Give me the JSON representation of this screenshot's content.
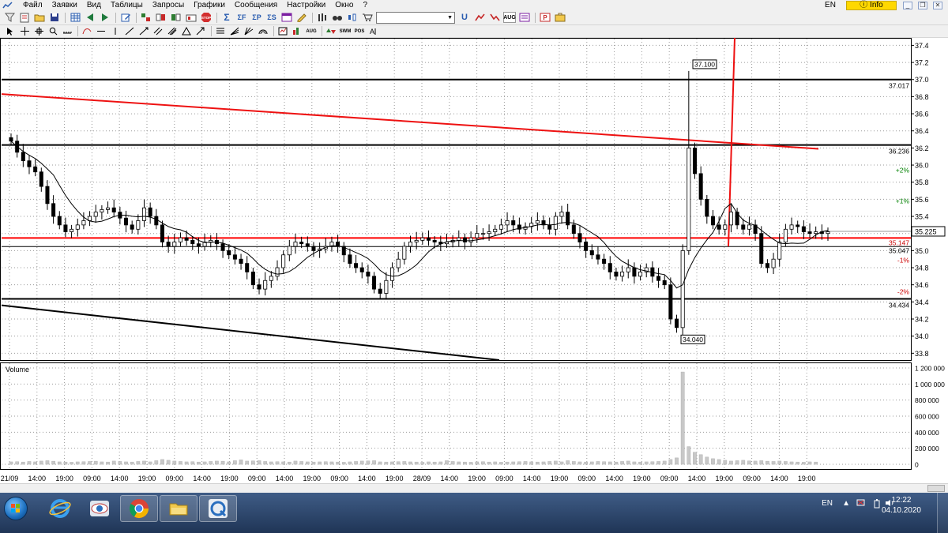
{
  "menu": {
    "items": [
      "Файл",
      "Заявки",
      "Вид",
      "Таблицы",
      "Запросы",
      "Графики",
      "Сообщения",
      "Настройки",
      "Окно",
      "?"
    ],
    "lang": "EN",
    "info_label": "Info"
  },
  "toolbar": {
    "stop_label": "STOP",
    "sigma_label": "Σ",
    "sigma_f_label": "ΣF",
    "sigma_p_label": "ΣP",
    "sigma_s_label": "ΣS",
    "symbol_value": "",
    "u_label": "U",
    "aug_label": "AUG",
    "pos_label": "POS",
    "swm_label": "SWM"
  },
  "chart_data": {
    "type": "candlestick",
    "price_axis": {
      "ticks": [
        "37.4",
        "37.2",
        "37.0",
        "36.8",
        "36.6",
        "36.4",
        "36.2",
        "36.0",
        "35.8",
        "35.6",
        "35.4",
        "35.2",
        "35.0",
        "34.8",
        "34.6",
        "34.4",
        "34.2",
        "34.0",
        "33.8"
      ],
      "ylim": [
        33.72,
        37.45
      ]
    },
    "levels": [
      {
        "label": "37.017",
        "value": 37.0,
        "color": "#000000"
      },
      {
        "label": "36.236",
        "value": 36.235,
        "color": "#000000"
      },
      {
        "label": "35.147",
        "value": 35.148,
        "color": "#ff0000"
      },
      {
        "label": "35.047",
        "value": 35.047,
        "color": "#000000"
      },
      {
        "label": "34.434",
        "value": 34.435,
        "color": "#000000"
      },
      {
        "label": "35.225",
        "value": 35.225,
        "color": "#000000"
      }
    ],
    "percent_labels": [
      {
        "label": "+2%",
        "value": 35.94,
        "color": "#008000"
      },
      {
        "label": "+1%",
        "value": 35.58,
        "color": "#008000"
      },
      {
        "label": "-1%",
        "value": 34.89,
        "color": "#cc0000"
      },
      {
        "label": "-2%",
        "value": 34.52,
        "color": "#cc0000"
      }
    ],
    "callouts": [
      {
        "label": "37.100",
        "value": 37.1
      },
      {
        "label": "34.040",
        "value": 34.04
      }
    ],
    "volume_panel": {
      "title": "Volume",
      "ticks": [
        "1 200 000",
        "1 000 000",
        "800 000",
        "600 000",
        "400 000",
        "200 000",
        "0"
      ],
      "ylim": [
        0,
        1200000
      ]
    },
    "time_labels": [
      "21/09",
      "14:00",
      "19:00",
      "09:00",
      "14:00",
      "19:00",
      "09:00",
      "14:00",
      "19:00",
      "09:00",
      "14:00",
      "19:00",
      "09:00",
      "14:00",
      "19:00",
      "28/09",
      "14:00",
      "19:00",
      "09:00",
      "14:00",
      "19:00",
      "09:00",
      "14:00",
      "19:00",
      "09:00",
      "14:00",
      "19:00",
      "09:00",
      "14:00",
      "19:00"
    ],
    "closes": [
      36.28,
      36.15,
      36.05,
      35.98,
      35.92,
      35.75,
      35.55,
      35.4,
      35.3,
      35.22,
      35.25,
      35.3,
      35.35,
      35.4,
      35.45,
      35.48,
      35.5,
      35.45,
      35.38,
      35.3,
      35.25,
      35.35,
      35.5,
      35.4,
      35.3,
      35.1,
      35.05,
      35.1,
      35.15,
      35.12,
      35.08,
      35.05,
      35.1,
      35.12,
      35.08,
      35.0,
      34.95,
      34.9,
      34.85,
      34.75,
      34.6,
      34.55,
      34.65,
      34.7,
      34.8,
      34.95,
      35.05,
      35.1,
      35.08,
      35.05,
      35.0,
      35.02,
      35.05,
      35.1,
      35.05,
      34.95,
      34.85,
      34.8,
      34.75,
      34.7,
      34.55,
      34.5,
      34.65,
      34.8,
      34.9,
      35.05,
      35.1,
      35.12,
      35.15,
      35.12,
      35.1,
      35.08,
      35.1,
      35.12,
      35.15,
      35.1,
      35.15,
      35.2,
      35.2,
      35.22,
      35.25,
      35.3,
      35.35,
      35.3,
      35.25,
      35.28,
      35.32,
      35.35,
      35.3,
      35.25,
      35.4,
      35.45,
      35.3,
      35.2,
      35.1,
      35.0,
      34.95,
      34.9,
      34.85,
      34.75,
      34.7,
      34.75,
      34.8,
      34.7,
      34.75,
      34.8,
      34.7,
      34.65,
      34.6,
      34.2,
      34.1,
      35.0,
      36.2,
      35.9,
      35.6,
      35.4,
      35.3,
      35.25,
      35.3,
      35.45,
      35.3,
      35.25,
      35.3,
      35.2,
      34.85,
      34.8,
      34.9,
      35.1,
      35.25,
      35.3,
      35.28,
      35.22,
      35.2,
      35.22,
      35.2,
      35.22
    ],
    "volumes": [
      30000,
      32000,
      28000,
      35000,
      30000,
      40000,
      45000,
      38000,
      30000,
      28000,
      25000,
      30000,
      32000,
      35000,
      38000,
      30000,
      28000,
      40000,
      35000,
      30000,
      28000,
      35000,
      40000,
      30000,
      45000,
      60000,
      50000,
      40000,
      35000,
      30000,
      32000,
      28000,
      30000,
      35000,
      40000,
      38000,
      30000,
      45000,
      55000,
      40000,
      42000,
      45000,
      35000,
      30000,
      32000,
      30000,
      28000,
      40000,
      35000,
      30000,
      28000,
      30000,
      32000,
      30000,
      28000,
      25000,
      30000,
      35000,
      40000,
      42000,
      45000,
      30000,
      28000,
      30000,
      32000,
      35000,
      30000,
      28000,
      25000,
      30000,
      28000,
      30000,
      45000,
      35000,
      30000,
      28000,
      25000,
      30000,
      32000,
      28000,
      30000,
      25000,
      28000,
      30000,
      32000,
      35000,
      30000,
      28000,
      30000,
      35000,
      40000,
      30000,
      45000,
      35000,
      30000,
      28000,
      30000,
      35000,
      32000,
      30000,
      28000,
      35000,
      40000,
      30000,
      28000,
      30000,
      32000,
      35000,
      40000,
      60000,
      80000,
      1150000,
      220000,
      150000,
      120000,
      90000,
      70000,
      60000,
      50000,
      40000,
      45000,
      50000,
      42000,
      40000,
      45000,
      38000,
      35000,
      40000,
      35000,
      30000,
      28000,
      25000,
      30000,
      28000
    ]
  },
  "taskbar": {
    "lang": "EN",
    "time": "12:22",
    "date": "04.10.2020"
  }
}
